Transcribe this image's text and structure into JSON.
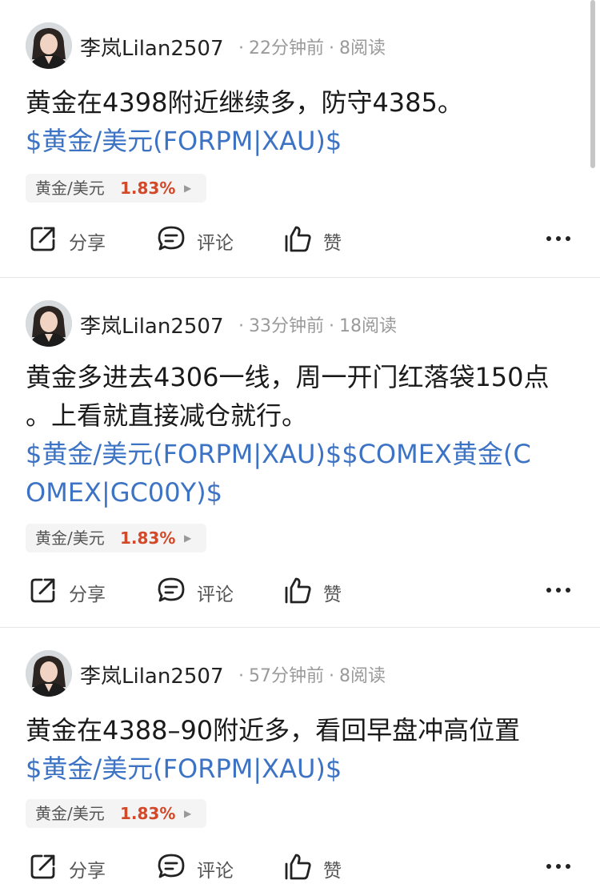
{
  "feed": {
    "posts": [
      {
        "author": "李岚Lilan2507",
        "time": "22分钟前",
        "reads": "8阅读",
        "text_lines": [
          "黄金在4398附近继续多，防守4385。"
        ],
        "tag_lines": [
          "$黄金/美元(FORPM|XAU)$"
        ],
        "chip": {
          "name": "黄金/美元",
          "pct": "1.83%"
        },
        "actions": {
          "share": "分享",
          "comment": "评论",
          "like": "赞"
        }
      },
      {
        "author": "李岚Lilan2507",
        "time": "33分钟前",
        "reads": "18阅读",
        "text_lines": [
          "黄金多进去4306一线，周一开门红落袋150点",
          "。上看就直接减仓就行。"
        ],
        "tag_lines": [
          "$黄金/美元(FORPM|XAU)$$COMEX黄金(C",
          "OMEX|GC00Y)$"
        ],
        "chip": {
          "name": "黄金/美元",
          "pct": "1.83%"
        },
        "actions": {
          "share": "分享",
          "comment": "评论",
          "like": "赞"
        }
      },
      {
        "author": "李岚Lilan2507",
        "time": "57分钟前",
        "reads": "8阅读",
        "text_lines": [
          "黄金在4388–90附近多，看回早盘冲高位置"
        ],
        "tag_lines": [
          "$黄金/美元(FORPM|XAU)$"
        ],
        "chip": {
          "name": "黄金/美元",
          "pct": "1.83%"
        },
        "actions": {
          "share": "分享",
          "comment": "评论",
          "like": "赞"
        }
      }
    ]
  },
  "icons": {
    "avatar": "avatar",
    "share": "share-icon",
    "comment": "comment-icon",
    "like": "thumbs-up-icon",
    "more": "more-horizontal-icon",
    "chip_arrow": "triangle-right-icon"
  },
  "colors": {
    "tag": "#3d73c4",
    "percent_up": "#d2492a",
    "meta": "#9a9a9a",
    "chip_bg": "#f4f4f4",
    "divider": "#e6e6e6"
  }
}
